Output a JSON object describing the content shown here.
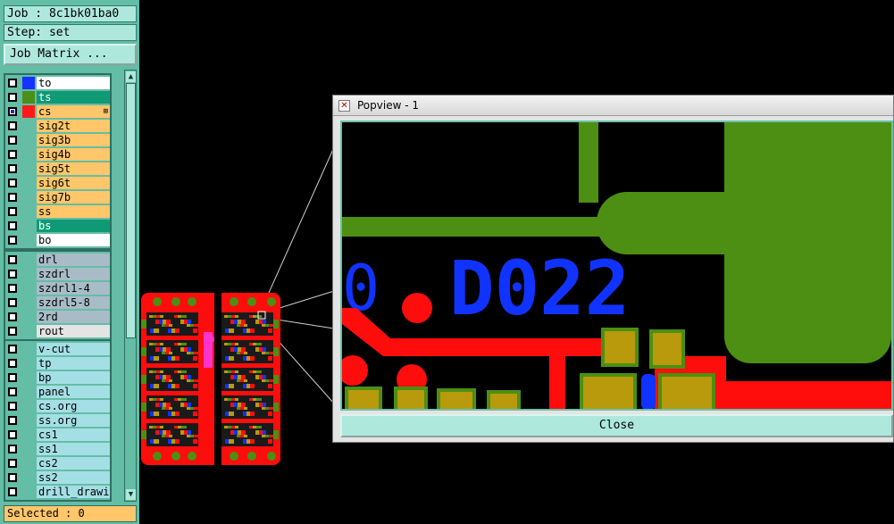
{
  "job": "Job : 8c1bk01ba0",
  "step": "Step: set",
  "job_matrix_label": "Job Matrix ...",
  "layer_groups": [
    [
      {
        "name": "to",
        "color": "#ffffff",
        "swatch": "#1533ff",
        "dark": false,
        "active": false
      },
      {
        "name": "ts",
        "color": "#0f9a75",
        "swatch": "#4b8f1a",
        "dark": true,
        "active": false
      },
      {
        "name": "cs",
        "color": "#ffc66a",
        "swatch": "#ff1a1a",
        "dark": false,
        "active": true,
        "mark": "⊞"
      },
      {
        "name": "sig2t",
        "color": "#ffc66a",
        "swatch": "",
        "dark": false,
        "active": false
      },
      {
        "name": "sig3b",
        "color": "#ffc66a",
        "swatch": "",
        "dark": false,
        "active": false
      },
      {
        "name": "sig4b",
        "color": "#ffc66a",
        "swatch": "",
        "dark": false,
        "active": false
      },
      {
        "name": "sig5t",
        "color": "#ffc66a",
        "swatch": "",
        "dark": false,
        "active": false
      },
      {
        "name": "sig6t",
        "color": "#ffc66a",
        "swatch": "",
        "dark": false,
        "active": false
      },
      {
        "name": "sig7b",
        "color": "#ffc66a",
        "swatch": "",
        "dark": false,
        "active": false
      },
      {
        "name": "ss",
        "color": "#ffc66a",
        "swatch": "",
        "dark": false,
        "active": false
      },
      {
        "name": "bs",
        "color": "#0f9a75",
        "swatch": "",
        "dark": true,
        "active": false
      },
      {
        "name": "bo",
        "color": "#ffffff",
        "swatch": "",
        "dark": false,
        "active": false
      }
    ],
    [
      {
        "name": "drl",
        "color": "#a8bcc7",
        "swatch": "",
        "dark": false,
        "active": false
      },
      {
        "name": "szdrl",
        "color": "#a8bcc7",
        "swatch": "",
        "dark": false,
        "active": false
      },
      {
        "name": "szdrl1-4",
        "color": "#a8bcc7",
        "swatch": "",
        "dark": false,
        "active": false
      },
      {
        "name": "szdrl5-8",
        "color": "#a8bcc7",
        "swatch": "",
        "dark": false,
        "active": false
      },
      {
        "name": "2rd",
        "color": "#a8bcc7",
        "swatch": "",
        "dark": false,
        "active": false
      },
      {
        "name": "rout",
        "color": "#e4e4e4",
        "swatch": "",
        "dark": false,
        "active": false
      }
    ],
    [
      {
        "name": "v-cut",
        "color": "#a5dfe6",
        "swatch": "",
        "dark": false,
        "active": false
      },
      {
        "name": "tp",
        "color": "#a5dfe6",
        "swatch": "",
        "dark": false,
        "active": false
      },
      {
        "name": "bp",
        "color": "#a5dfe6",
        "swatch": "",
        "dark": false,
        "active": false
      },
      {
        "name": "panel",
        "color": "#a5dfe6",
        "swatch": "",
        "dark": false,
        "active": false
      },
      {
        "name": "cs.org",
        "color": "#a5dfe6",
        "swatch": "",
        "dark": false,
        "active": false
      },
      {
        "name": "ss.org",
        "color": "#a5dfe6",
        "swatch": "",
        "dark": false,
        "active": false
      },
      {
        "name": "cs1",
        "color": "#a5dfe6",
        "swatch": "",
        "dark": false,
        "active": false
      },
      {
        "name": "ss1",
        "color": "#a5dfe6",
        "swatch": "",
        "dark": false,
        "active": false
      },
      {
        "name": "cs2",
        "color": "#a5dfe6",
        "swatch": "",
        "dark": false,
        "active": false
      },
      {
        "name": "ss2",
        "color": "#a5dfe6",
        "swatch": "",
        "dark": false,
        "active": false
      },
      {
        "name": "drill_drawing",
        "color": "#a5dfe6",
        "swatch": "",
        "dark": false,
        "active": false
      }
    ]
  ],
  "selected_status": "Selected : 0",
  "popview": {
    "title": "Popview - 1",
    "designator": "D022",
    "partial_designator": "0",
    "close_label": "Close"
  },
  "colors": {
    "trace_red": "#ff0d0d",
    "copper_green": "#4c8f12",
    "pad_gold": "#b89a0c",
    "silk_blue": "#1133ff",
    "panel_accent": "#64bda5"
  }
}
